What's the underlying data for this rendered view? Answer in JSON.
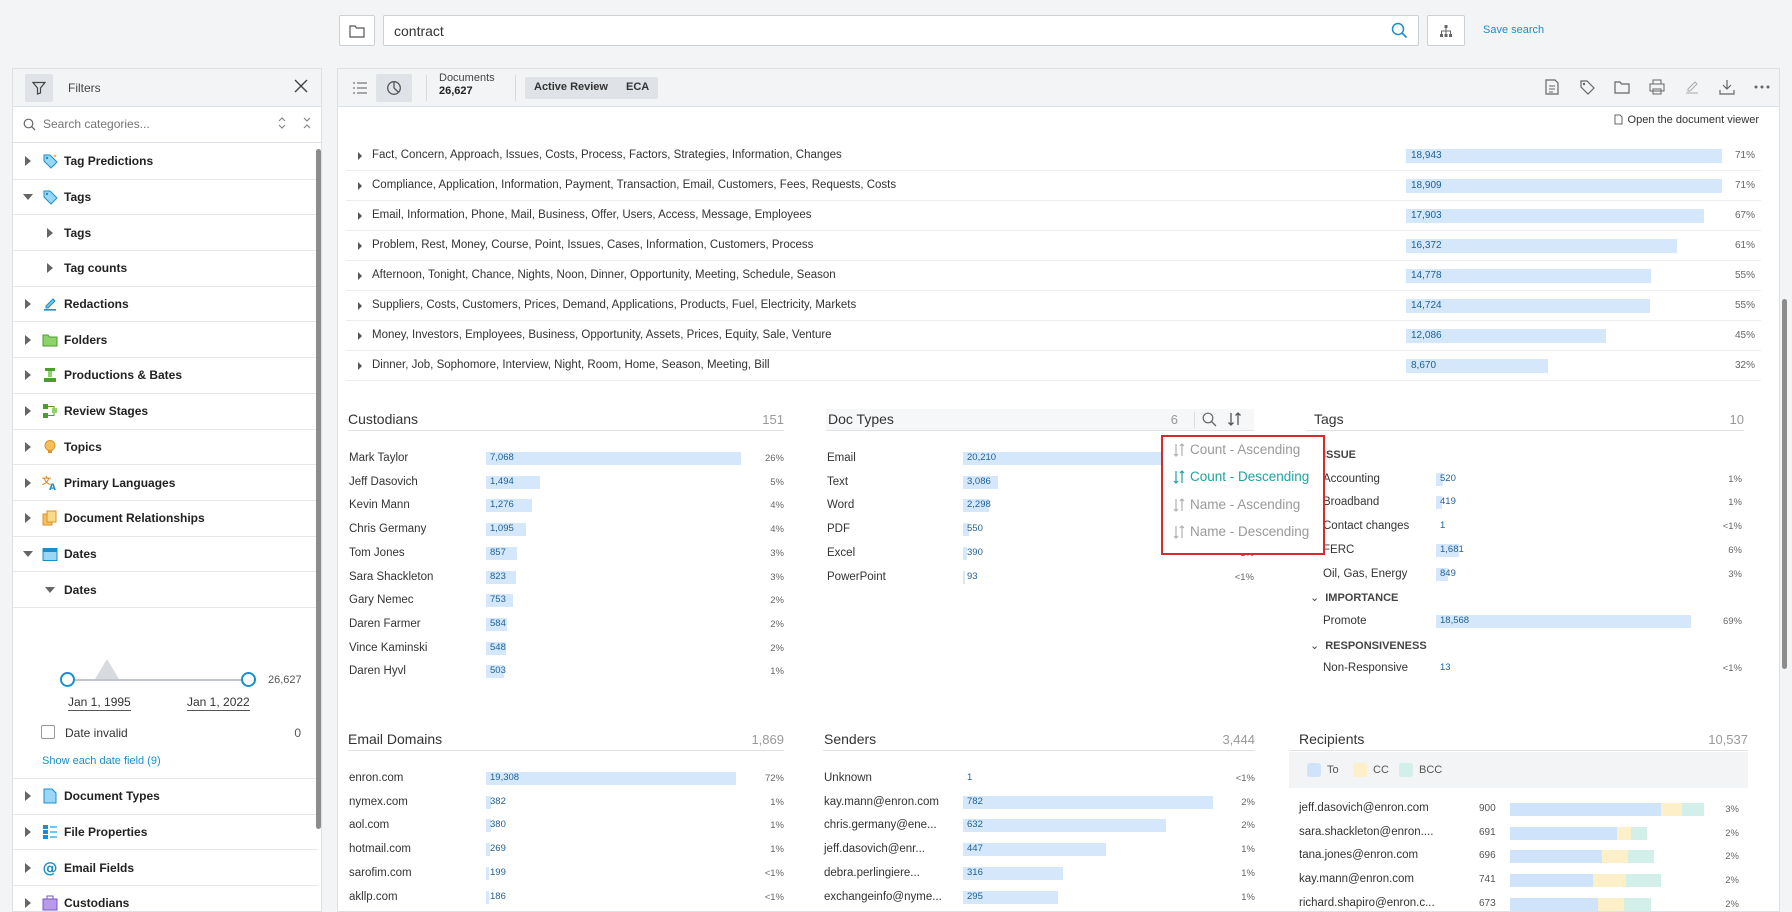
{
  "search": {
    "query": "contract",
    "save_label": "Save search"
  },
  "filters": {
    "title": "Filters",
    "search_placeholder": "Search categories...",
    "categories_top": [
      {
        "label": "Tag Predictions",
        "icon": "tag-prediction-icon",
        "expanded": false
      },
      {
        "label": "Tags",
        "icon": "tag-icon",
        "expanded": true
      }
    ],
    "tags_children": [
      {
        "label": "Tags"
      },
      {
        "label": "Tag counts"
      }
    ],
    "categories_mid": [
      {
        "label": "Redactions",
        "icon": "redaction-icon"
      },
      {
        "label": "Folders",
        "icon": "folder-icon"
      },
      {
        "label": "Productions & Bates",
        "icon": "productions-icon"
      },
      {
        "label": "Review Stages",
        "icon": "review-stages-icon"
      },
      {
        "label": "Topics",
        "icon": "lightbulb-icon"
      },
      {
        "label": "Primary Languages",
        "icon": "language-icon"
      },
      {
        "label": "Document Relationships",
        "icon": "relationships-icon"
      },
      {
        "label": "Dates",
        "icon": "calendar-icon"
      }
    ],
    "dates_child": "Dates",
    "date_range": {
      "start": "Jan 1, 1995",
      "end": "Jan 1, 2022",
      "count": "26,627"
    },
    "date_invalid": {
      "label": "Date invalid",
      "count": "0"
    },
    "show_each": "Show each date field (9)",
    "categories_bottom": [
      {
        "label": "Document Types",
        "icon": "document-types-icon"
      },
      {
        "label": "File Properties",
        "icon": "file-properties-icon"
      },
      {
        "label": "Email Fields",
        "icon": "at-icon"
      },
      {
        "label": "Custodians",
        "icon": "custodians-icon"
      }
    ]
  },
  "toolbar": {
    "documents_label": "Documents",
    "documents_count": "26,627",
    "tabs": [
      "Active Review",
      "ECA"
    ],
    "open_viewer": "Open the document viewer"
  },
  "topics": [
    {
      "text": "Fact, Concern, Approach, Issues, Costs, Process, Factors, Strategies, Information, Changes",
      "value": "18,943",
      "pct": "71%",
      "frac": 0.71
    },
    {
      "text": "Compliance, Application, Information, Payment, Transaction, Email, Customers, Fees, Requests, Costs",
      "value": "18,909",
      "pct": "71%",
      "frac": 0.709
    },
    {
      "text": "Email, Information, Phone, Mail, Business, Offer, Users, Access, Message, Employees",
      "value": "17,903",
      "pct": "67%",
      "frac": 0.67
    },
    {
      "text": "Problem, Rest, Money, Course, Point, Issues, Cases, Information, Customers, Process",
      "value": "16,372",
      "pct": "61%",
      "frac": 0.61
    },
    {
      "text": "Afternoon, Tonight, Chance, Nights, Noon, Dinner, Opportunity, Meeting, Schedule, Season",
      "value": "14,778",
      "pct": "55%",
      "frac": 0.55
    },
    {
      "text": "Suppliers, Costs, Customers, Prices, Demand, Applications, Products, Fuel, Electricity, Markets",
      "value": "14,724",
      "pct": "55%",
      "frac": 0.548
    },
    {
      "text": "Money, Investors, Employees, Business, Opportunity, Assets, Prices, Equity, Sale, Venture",
      "value": "12,086",
      "pct": "45%",
      "frac": 0.45
    },
    {
      "text": "Dinner, Job, Sophomore, Interview, Night, Room, Home, Season, Meeting, Bill",
      "value": "8,670",
      "pct": "32%",
      "frac": 0.32
    }
  ],
  "custodians": {
    "title": "Custodians",
    "count": "151",
    "rows": [
      {
        "name": "Mark Taylor",
        "value": "7,068",
        "pct": "26%",
        "frac": 1.0
      },
      {
        "name": "Jeff Dasovich",
        "value": "1,494",
        "pct": "5%",
        "frac": 0.21
      },
      {
        "name": "Kevin Mann",
        "value": "1,276",
        "pct": "4%",
        "frac": 0.18
      },
      {
        "name": "Chris Germany",
        "value": "1,095",
        "pct": "4%",
        "frac": 0.155
      },
      {
        "name": "Tom Jones",
        "value": "857",
        "pct": "3%",
        "frac": 0.121
      },
      {
        "name": "Sara Shackleton",
        "value": "823",
        "pct": "3%",
        "frac": 0.116
      },
      {
        "name": "Gary Nemec",
        "value": "753",
        "pct": "2%",
        "frac": 0.107
      },
      {
        "name": "Daren Farmer",
        "value": "584",
        "pct": "2%",
        "frac": 0.083
      },
      {
        "name": "Vince Kaminski",
        "value": "548",
        "pct": "2%",
        "frac": 0.078
      },
      {
        "name": "Daren Hyvl",
        "value": "503",
        "pct": "1%",
        "frac": 0.071
      }
    ]
  },
  "doc_types": {
    "title": "Doc Types",
    "count": "6",
    "rows": [
      {
        "name": "Email",
        "value": "20,210",
        "pct": "",
        "frac": 1.0
      },
      {
        "name": "Text",
        "value": "3,086",
        "pct": "",
        "frac": 0.153
      },
      {
        "name": "Word",
        "value": "2,298",
        "pct": "",
        "frac": 0.114
      },
      {
        "name": "PDF",
        "value": "550",
        "pct": "",
        "frac": 0.027
      },
      {
        "name": "Excel",
        "value": "390",
        "pct": "1%",
        "frac": 0.019
      },
      {
        "name": "PowerPoint",
        "value": "93",
        "pct": "<1%",
        "frac": 0.005
      }
    ]
  },
  "sort_menu": {
    "items": [
      {
        "label": "Count - Ascending",
        "active": false
      },
      {
        "label": "Count - Descending",
        "active": true
      },
      {
        "label": "Name - Ascending",
        "active": false
      },
      {
        "label": "Name - Descending",
        "active": false
      }
    ]
  },
  "tags": {
    "title": "Tags",
    "count": "10",
    "sections": [
      {
        "name": "ISSUE",
        "rows": [
          {
            "name": "Accounting",
            "value": "520",
            "pct": "1%",
            "frac": 0.028
          },
          {
            "name": "Broadband",
            "value": "419",
            "pct": "1%",
            "frac": 0.023
          },
          {
            "name": "Contact changes",
            "value": "1",
            "pct": "<1%",
            "frac": 0.0
          },
          {
            "name": "FERC",
            "value": "1,681",
            "pct": "6%",
            "frac": 0.09
          },
          {
            "name": "Oil, Gas, Energy",
            "value": "849",
            "pct": "3%",
            "frac": 0.046
          }
        ]
      },
      {
        "name": "IMPORTANCE",
        "rows": [
          {
            "name": "Promote",
            "value": "18,568",
            "pct": "69%",
            "frac": 1.0
          }
        ]
      },
      {
        "name": "RESPONSIVENESS",
        "rows": [
          {
            "name": "Non-Responsive",
            "value": "13",
            "pct": "<1%",
            "frac": 0.0
          }
        ]
      }
    ]
  },
  "email_domains": {
    "title": "Email Domains",
    "count": "1,869",
    "rows": [
      {
        "name": "enron.com",
        "value": "19,308",
        "pct": "72%",
        "frac": 1.0
      },
      {
        "name": "nymex.com",
        "value": "382",
        "pct": "1%",
        "frac": 0.02
      },
      {
        "name": "aol.com",
        "value": "380",
        "pct": "1%",
        "frac": 0.02
      },
      {
        "name": "hotmail.com",
        "value": "269",
        "pct": "1%",
        "frac": 0.014
      },
      {
        "name": "sarofim.com",
        "value": "199",
        "pct": "<1%",
        "frac": 0.01
      },
      {
        "name": "akllp.com",
        "value": "186",
        "pct": "<1%",
        "frac": 0.01
      }
    ]
  },
  "senders": {
    "title": "Senders",
    "count": "3,444",
    "rows": [
      {
        "name": "Unknown",
        "value": "1",
        "pct": "<1%",
        "frac": 0.0
      },
      {
        "name": "kay.mann@enron.com",
        "value": "782",
        "pct": "2%",
        "frac": 1.0
      },
      {
        "name": "chris.germany@ene...",
        "value": "632",
        "pct": "2%",
        "frac": 0.81
      },
      {
        "name": "jeff.dasovich@enr...",
        "value": "447",
        "pct": "1%",
        "frac": 0.57
      },
      {
        "name": "debra.perlingiere...",
        "value": "316",
        "pct": "1%",
        "frac": 0.4
      },
      {
        "name": "exchangeinfo@nyme...",
        "value": "295",
        "pct": "1%",
        "frac": 0.38
      }
    ]
  },
  "recipients": {
    "title": "Recipients",
    "count": "10,537",
    "legend": [
      {
        "label": "To",
        "color": "#cfe4fb"
      },
      {
        "label": "CC",
        "color": "#fdf0c8"
      },
      {
        "label": "BCC",
        "color": "#d2efe9"
      }
    ],
    "rows": [
      {
        "name": "jeff.dasovich@enron.com",
        "count": "900",
        "pct": "3%",
        "to": 0.86,
        "cc": 0.12,
        "bcc": 0.12
      },
      {
        "name": "sara.shackleton@enron....",
        "count": "691",
        "pct": "2%",
        "to": 0.61,
        "cc": 0.08,
        "bcc": 0.09
      },
      {
        "name": "tana.jones@enron.com",
        "count": "696",
        "pct": "2%",
        "to": 0.52,
        "cc": 0.15,
        "bcc": 0.15
      },
      {
        "name": "kay.mann@enron.com",
        "count": "741",
        "pct": "2%",
        "to": 0.47,
        "cc": 0.19,
        "bcc": 0.2
      },
      {
        "name": "richard.shapiro@enron.c...",
        "count": "673",
        "pct": "2%",
        "to": 0.5,
        "cc": 0.15,
        "bcc": 0.15
      }
    ]
  }
}
